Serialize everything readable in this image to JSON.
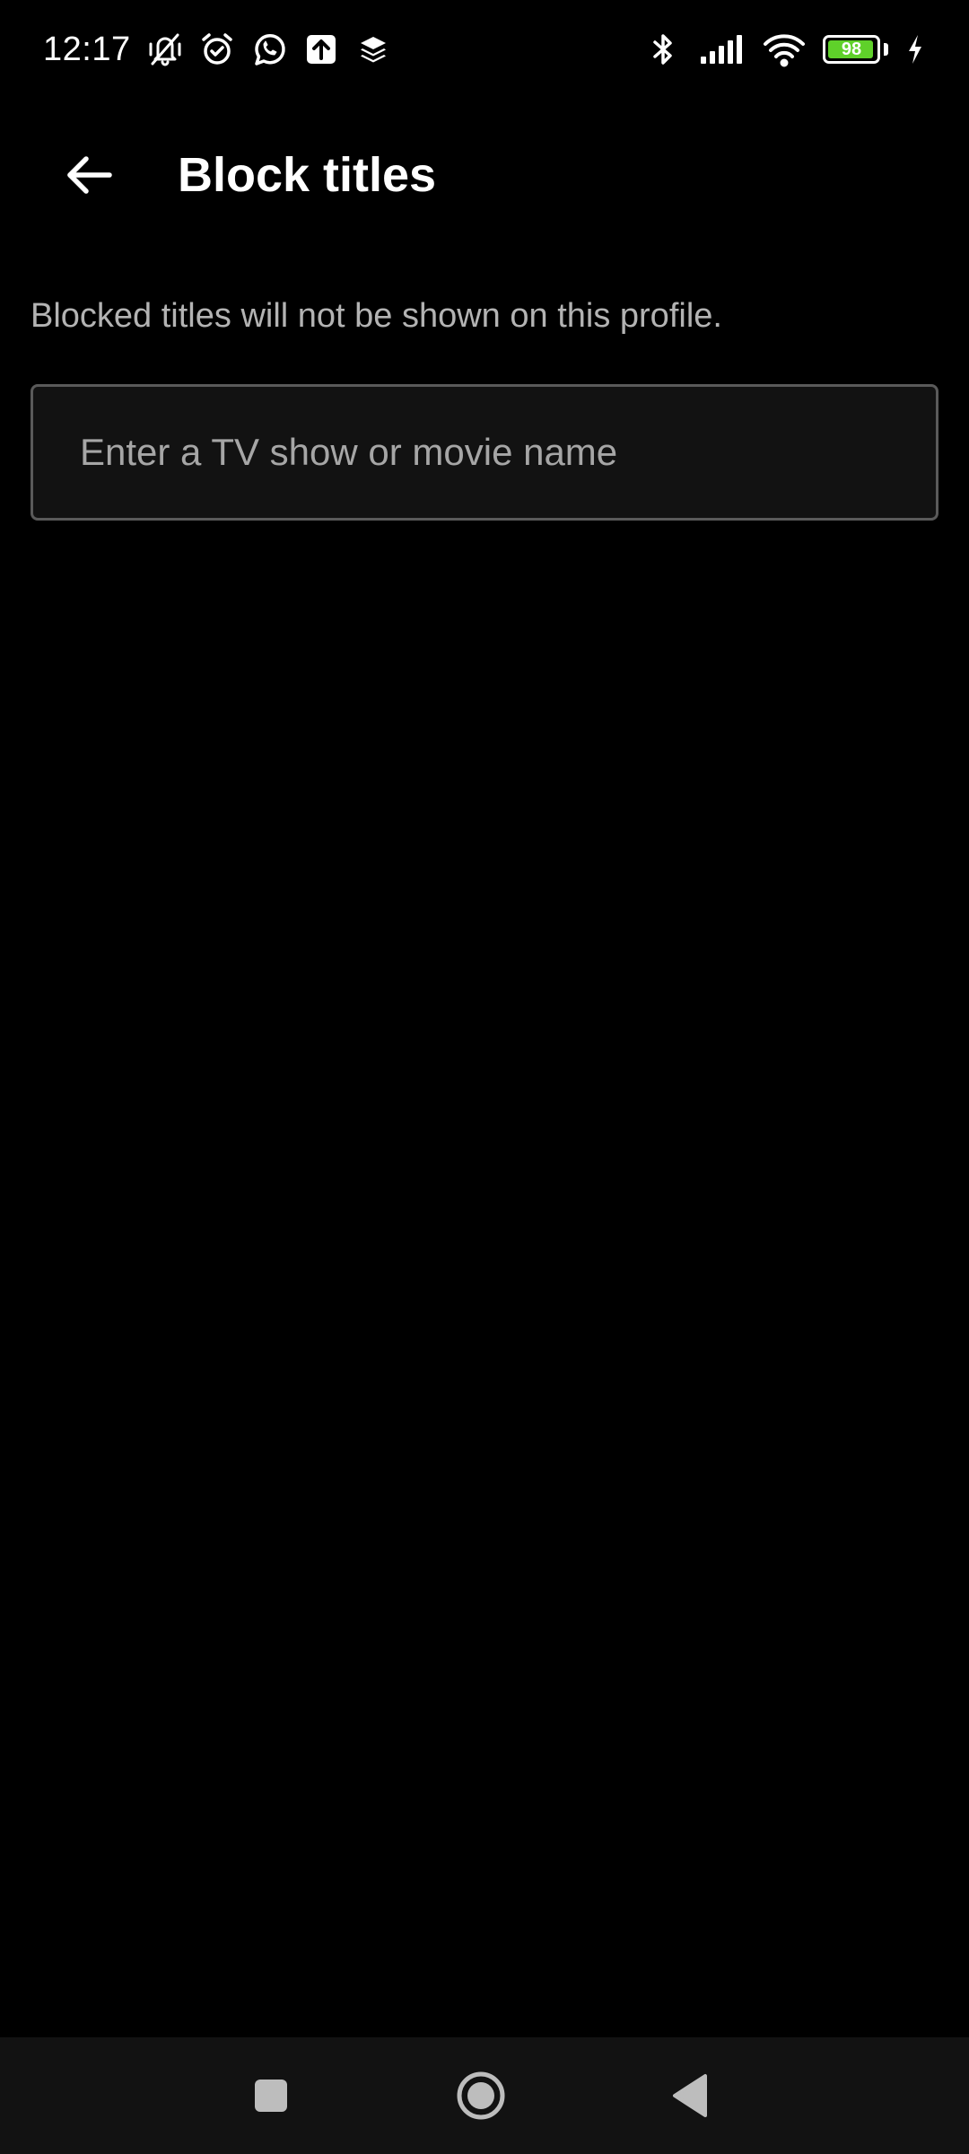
{
  "status_bar": {
    "time": "12:17",
    "battery_level": 98,
    "battery_label": "98",
    "battery_color": "#5fd12a",
    "left_icons": [
      "vibrate-mute-icon",
      "alarm-icon",
      "whatsapp-icon",
      "upload-icon",
      "layers-icon"
    ],
    "right_icons": [
      "bluetooth-icon",
      "signal-icon",
      "wifi-icon",
      "battery-icon",
      "charging-icon"
    ]
  },
  "header": {
    "back_icon": "arrow-left-icon",
    "title": "Block titles"
  },
  "main": {
    "description": "Blocked titles will not be shown on this profile.",
    "search": {
      "value": "",
      "placeholder": "Enter a TV show or movie name"
    }
  },
  "nav_bar": {
    "buttons": [
      "recents-icon",
      "home-icon",
      "back-triangle-icon"
    ]
  },
  "colors": {
    "background": "#000000",
    "input_background": "#121212",
    "input_border": "#5a5a5a",
    "secondary_text": "#b3b3b3",
    "nav_bar_background": "#121212"
  }
}
